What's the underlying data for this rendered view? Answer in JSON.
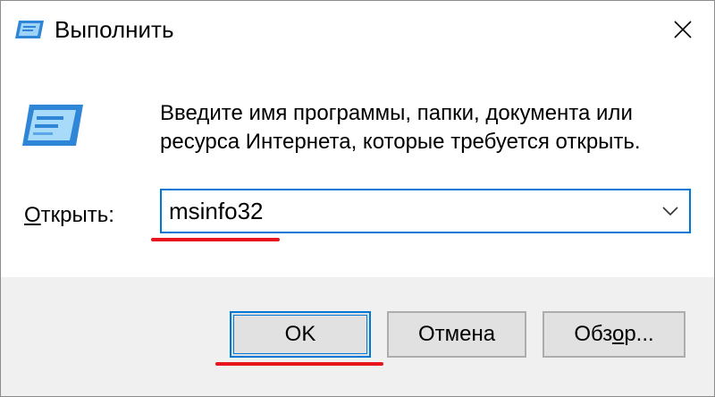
{
  "window": {
    "title": "Выполнить"
  },
  "dialog": {
    "description": "Введите имя программы, папки, документа или ресурса Интернета, которые требуется открыть.",
    "open_label_first": "О",
    "open_label_rest": "ткрыть:",
    "input_value": "msinfo32"
  },
  "buttons": {
    "ok_label": "OK",
    "cancel_label": "Отмена",
    "browse_label_a": "Обз",
    "browse_label_b": "о",
    "browse_label_c": "р..."
  },
  "icons": {
    "title": "run-icon",
    "large": "run-icon",
    "close": "close-icon",
    "dropdown": "chevron-down-icon"
  },
  "colors": {
    "accent": "#0078d7",
    "annotation": "#e8141e",
    "footer_bg": "#f0f0f0",
    "button_bg": "#e1e1e1"
  }
}
